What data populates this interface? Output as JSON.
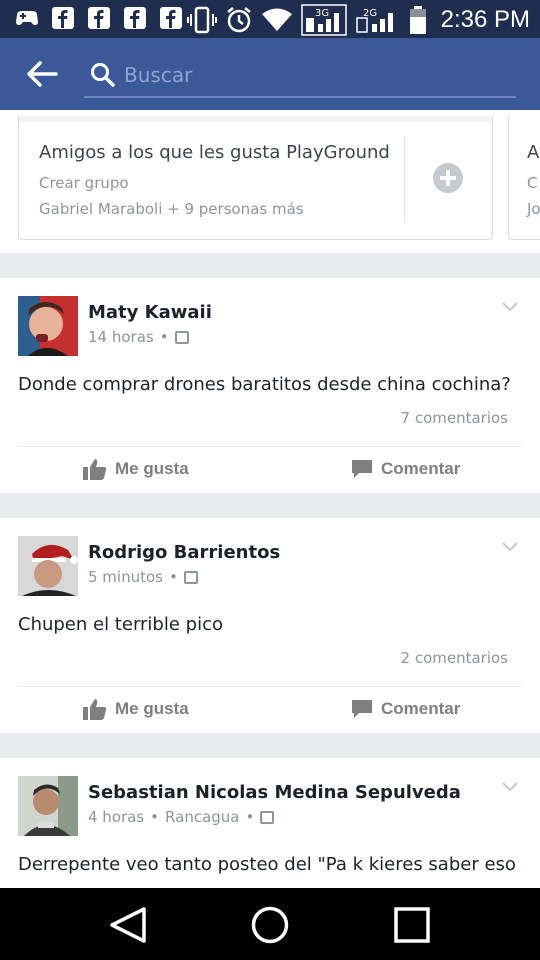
{
  "status_bar": {
    "time": "2:36 PM",
    "network_1": "3G",
    "network_2": "2G"
  },
  "app_bar": {
    "search_placeholder": "Buscar"
  },
  "groups": [
    {
      "title": "Amigos a los que les gusta PlayGround",
      "action": "Crear grupo",
      "members": "Gabriel Maraboli + 9 personas más"
    },
    {
      "title": "A",
      "action": "C",
      "members": "Jo"
    }
  ],
  "posts": [
    {
      "author": "Maty Kawaii",
      "time": "14 horas",
      "location": "",
      "text": "Donde comprar drones baratitos desde china cochina?",
      "comments": "7 comentarios",
      "like_label": "Me gusta",
      "comment_label": "Comentar"
    },
    {
      "author": "Rodrigo Barrientos",
      "time": "5 minutos",
      "location": "",
      "text": "Chupen el terrible pico",
      "comments": "2 comentarios",
      "like_label": "Me gusta",
      "comment_label": "Comentar"
    },
    {
      "author": "Sebastian Nicolas Medina Sepulveda",
      "time": "4 horas",
      "location": "Rancagua",
      "text": "Derrepente veo tanto posteo del \"Pa k kieres saber eso",
      "comments": "",
      "like_label": "",
      "comment_label": ""
    }
  ],
  "colors": {
    "brand": "#3b5998",
    "status_bar": "#1f2d4e",
    "feed_bg": "#e9ebee",
    "muted_text": "#90949c"
  }
}
